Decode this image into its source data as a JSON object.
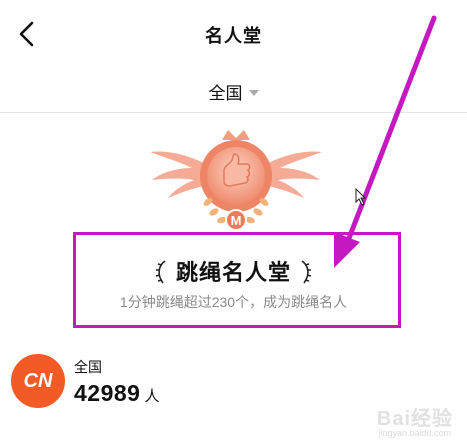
{
  "header": {
    "title": "名人堂",
    "back_icon": "chevron-left-icon"
  },
  "region_selector": {
    "value": "全国",
    "icon": "caret-down-icon"
  },
  "hall_of_fame": {
    "title": "跳绳名人堂",
    "subtitle": "1分钟跳绳超过230个，成为跳绳名人",
    "badge_letter": "M"
  },
  "stat": {
    "avatar_text": "CN",
    "label": "全国",
    "value": "42989",
    "unit": "人"
  },
  "watermark": {
    "brand": "Bai经验",
    "url": "jingyan.baidu.com"
  },
  "colors": {
    "annotation": "#c418c0",
    "avatar_bg": "#f25a26",
    "badge": "#f08a6e"
  }
}
